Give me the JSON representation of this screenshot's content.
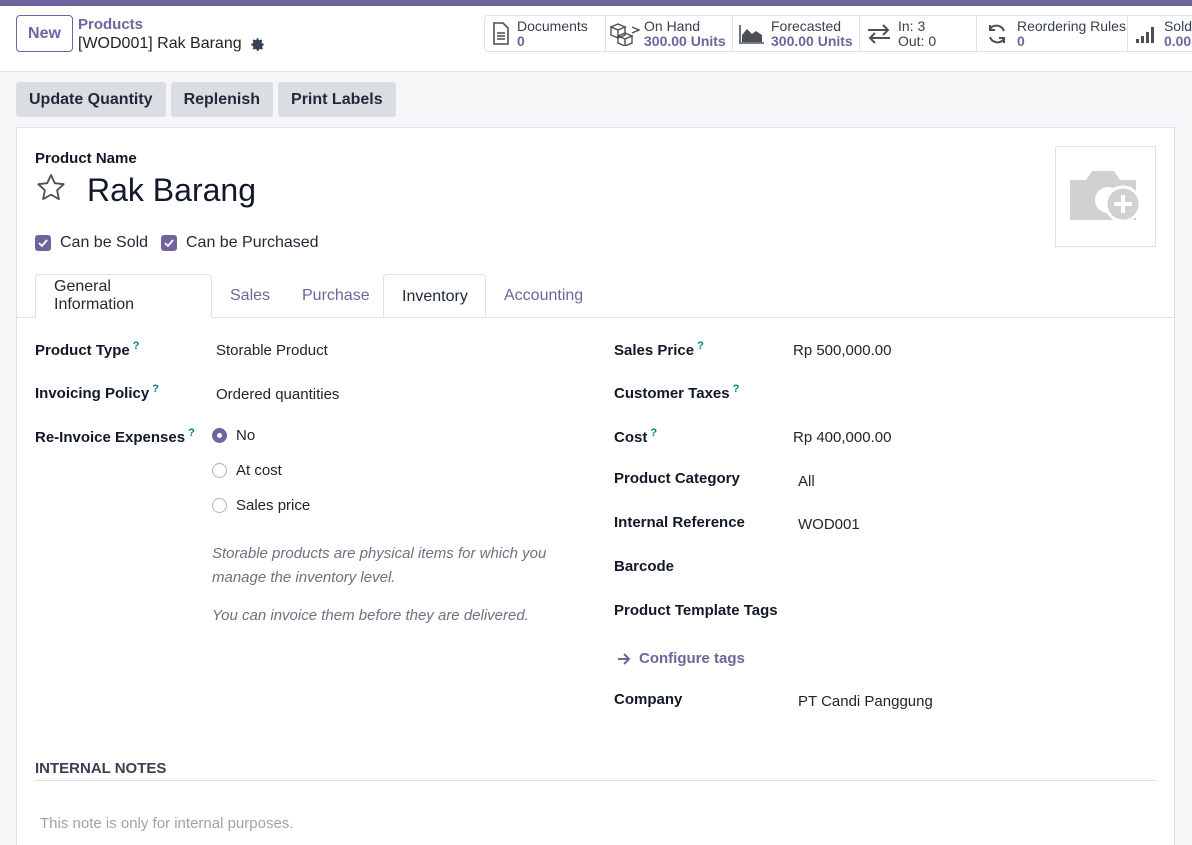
{
  "control": {
    "new_label": "New",
    "breadcrumb_parent": "Products",
    "breadcrumb_current": "[WOD001] Rak Barang"
  },
  "stats": [
    {
      "label": "Documents",
      "value": "0",
      "icon": "document-icon"
    },
    {
      "label": "On Hand",
      "value": "300.00 Units",
      "icon": "cubes-icon"
    },
    {
      "label": "Forecasted",
      "value": "300.00 Units",
      "icon": "area-chart-icon"
    },
    {
      "label": "In: 3",
      "value": "Out: 0",
      "icon": "arrows-exchange-icon"
    },
    {
      "label": "Reordering Rules",
      "value": "0",
      "icon": "refresh-icon"
    },
    {
      "label": "Sold",
      "value": "0.00",
      "icon": "bar-signal-icon"
    }
  ],
  "actions": [
    "Update Quantity",
    "Replenish",
    "Print Labels"
  ],
  "product": {
    "name_label": "Product Name",
    "name": "Rak Barang",
    "can_be_sold": "Can be Sold",
    "can_be_purchased": "Can be Purchased"
  },
  "tabs": [
    "General Information",
    "Sales",
    "Purchase",
    "Inventory",
    "Accounting"
  ],
  "left_fields": {
    "product_type_label": "Product Type",
    "product_type_value": "Storable Product",
    "invoicing_policy_label": "Invoicing Policy",
    "invoicing_policy_value": "Ordered quantities",
    "reinvoice_label": "Re-Invoice Expenses",
    "reinvoice_options": [
      "No",
      "At cost",
      "Sales price"
    ],
    "help_text_1": "Storable products are physical items for which you manage the inventory level.",
    "help_text_2": "You can invoice them before they are delivered."
  },
  "right_fields": {
    "sales_price_label": "Sales Price",
    "sales_price_value": "Rp 500,000.00",
    "customer_taxes_label": "Customer Taxes",
    "cost_label": "Cost",
    "cost_value": "Rp 400,000.00",
    "category_label": "Product Category",
    "category_value": "All",
    "internal_ref_label": "Internal Reference",
    "internal_ref_value": "WOD001",
    "barcode_label": "Barcode",
    "tags_label": "Product Template Tags",
    "configure_tags": "Configure tags",
    "company_label": "Company",
    "company_value": "PT Candi Panggung"
  },
  "notes": {
    "title": "INTERNAL NOTES",
    "placeholder": "This note is only for internal purposes."
  },
  "help_marker": "?",
  "colors": {
    "accent": "#71639e",
    "help": "#017e84"
  }
}
